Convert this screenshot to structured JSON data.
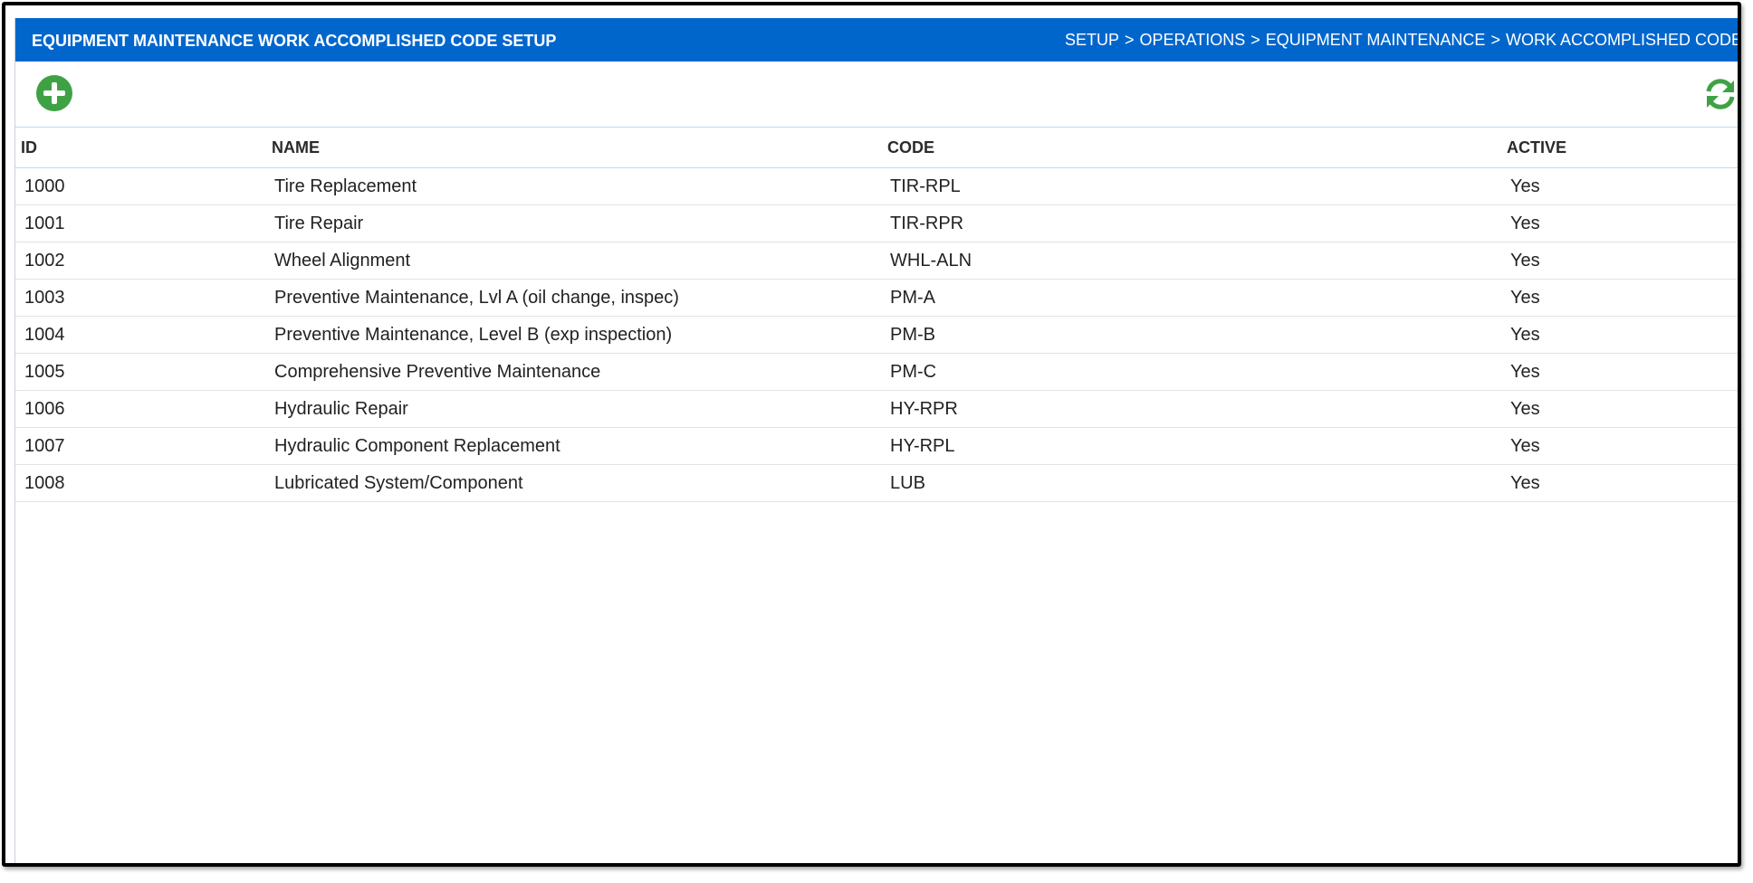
{
  "header": {
    "title": "EQUIPMENT MAINTENANCE WORK ACCOMPLISHED CODE SETUP",
    "breadcrumb": [
      "SETUP",
      "OPERATIONS",
      "EQUIPMENT MAINTENANCE",
      "WORK ACCOMPLISHED CODE"
    ],
    "breadcrumb_separator": ">"
  },
  "toolbar": {
    "add_icon": "plus-circle-icon",
    "refresh_icon": "refresh-icon",
    "accent_color": "#3ea245"
  },
  "colors": {
    "header_bg": "#0066cc",
    "header_text": "#ffffff"
  },
  "table": {
    "columns": [
      "ID",
      "NAME",
      "CODE",
      "ACTIVE"
    ],
    "rows": [
      {
        "id": "1000",
        "name": "Tire Replacement",
        "code": "TIR-RPL",
        "active": "Yes"
      },
      {
        "id": "1001",
        "name": "Tire Repair",
        "code": "TIR-RPR",
        "active": "Yes"
      },
      {
        "id": "1002",
        "name": "Wheel Alignment",
        "code": "WHL-ALN",
        "active": "Yes"
      },
      {
        "id": "1003",
        "name": "Preventive Maintenance, Lvl A (oil change, inspec)",
        "code": "PM-A",
        "active": "Yes"
      },
      {
        "id": "1004",
        "name": "Preventive Maintenance, Level B (exp inspection)",
        "code": "PM-B",
        "active": "Yes"
      },
      {
        "id": "1005",
        "name": "Comprehensive Preventive Maintenance",
        "code": "PM-C",
        "active": "Yes"
      },
      {
        "id": "1006",
        "name": "Hydraulic Repair",
        "code": "HY-RPR",
        "active": "Yes"
      },
      {
        "id": "1007",
        "name": "Hydraulic Component Replacement",
        "code": "HY-RPL",
        "active": "Yes"
      },
      {
        "id": "1008",
        "name": "Lubricated System/Component",
        "code": "LUB",
        "active": "Yes"
      }
    ]
  }
}
